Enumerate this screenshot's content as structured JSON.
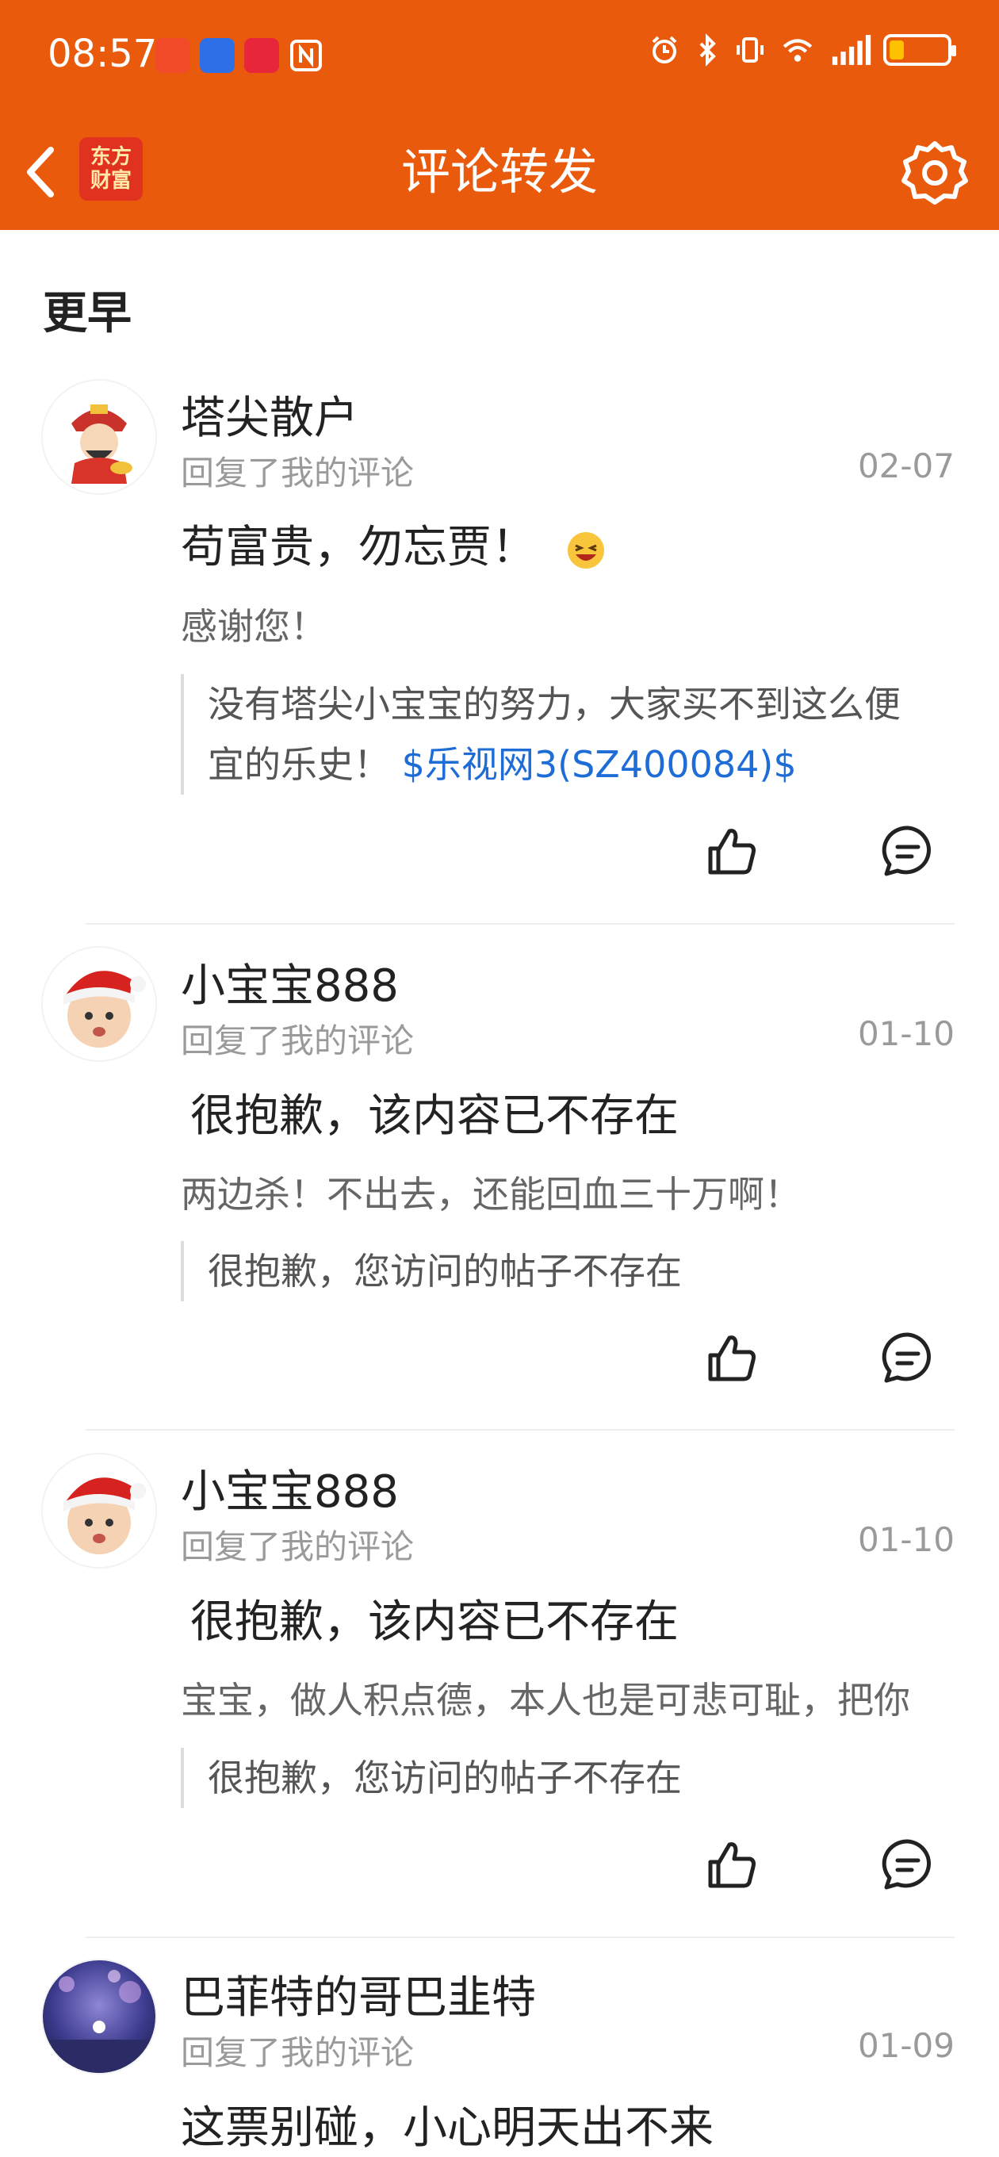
{
  "status_bar": {
    "time": "08:57"
  },
  "nav": {
    "title": "评论转发",
    "logo_line1": "东方",
    "logo_line2": "财富"
  },
  "section": {
    "title": "更早"
  },
  "items": [
    {
      "username": "塔尖散户",
      "action": "回复了我的评论",
      "date": "02-07",
      "main_text": "苟富贵，勿忘贾！",
      "my_comment": "感谢您！",
      "quote_text": "没有塔尖小宝宝的努力，大家买不到这么便宜的乐史！",
      "quote_stock": "$乐视网3(SZ400084)$"
    },
    {
      "username": "小宝宝888",
      "action": "回复了我的评论",
      "date": "01-10",
      "main_text": "很抱歉，该内容已不存在",
      "my_comment": "两边杀！不出去，还能回血三十万啊！",
      "quote_text": "很抱歉，您访问的帖子不存在"
    },
    {
      "username": "小宝宝888",
      "action": "回复了我的评论",
      "date": "01-10",
      "main_text": "很抱歉，该内容已不存在",
      "my_comment": "宝宝，做人积点德，本人也是可悲可耻，把你",
      "quote_text": "很抱歉，您访问的帖子不存在"
    },
    {
      "username": "巴菲特的哥巴韭特",
      "action": "回复了我的评论",
      "date": "01-09",
      "main_text": "这票别碰，小心明天出不来"
    }
  ],
  "colors": {
    "brand": "#EA5A0C",
    "link": "#1E6CD6"
  }
}
